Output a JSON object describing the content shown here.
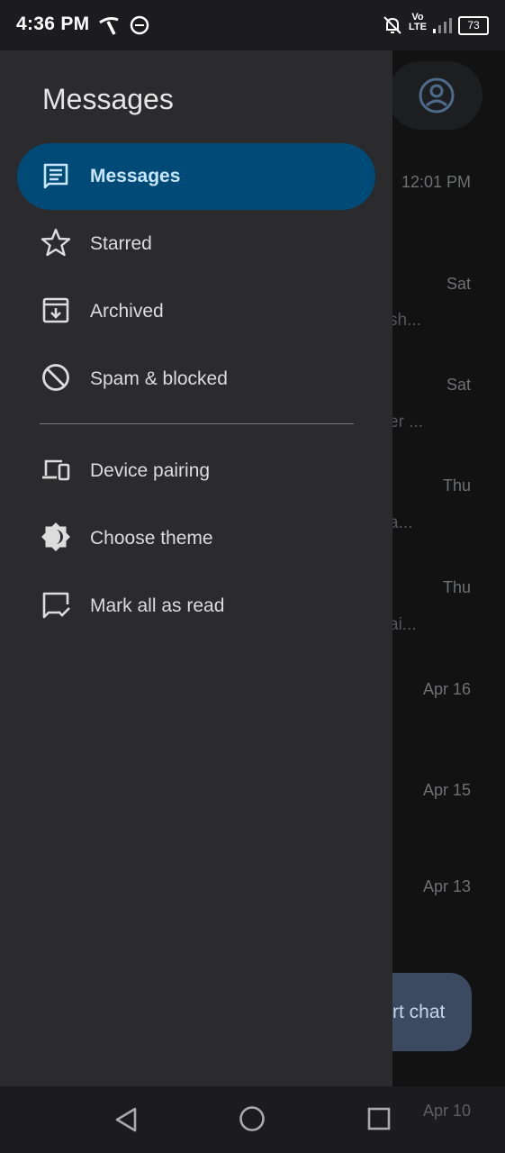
{
  "status_bar": {
    "time": "4:36 PM",
    "network_label_top": "Vo",
    "network_label_bottom": "LTE",
    "battery": "73"
  },
  "background": {
    "dates": [
      "12:01 PM",
      "Sat",
      "Sat",
      "Thu",
      "Thu",
      "Apr 16",
      "Apr 15",
      "Apr 13",
      "Apr 10"
    ],
    "snippets": [
      "sh...",
      "er ...",
      "a...",
      "ai...",
      "."
    ],
    "fab_label": "rt chat"
  },
  "drawer": {
    "title": "Messages",
    "items": [
      {
        "label": "Messages",
        "icon": "messages-icon",
        "active": true
      },
      {
        "label": "Starred",
        "icon": "star-icon"
      },
      {
        "label": "Archived",
        "icon": "archive-icon"
      },
      {
        "label": "Spam & blocked",
        "icon": "block-icon"
      },
      {
        "label": "Device pairing",
        "icon": "devices-icon"
      },
      {
        "label": "Choose theme",
        "icon": "theme-icon"
      },
      {
        "label": "Mark all as read",
        "icon": "mark-read-icon"
      }
    ]
  },
  "colors": {
    "drawer_bg": "#2b2b2d",
    "active_bg": "#004a77",
    "active_text": "#c8e6ff"
  }
}
